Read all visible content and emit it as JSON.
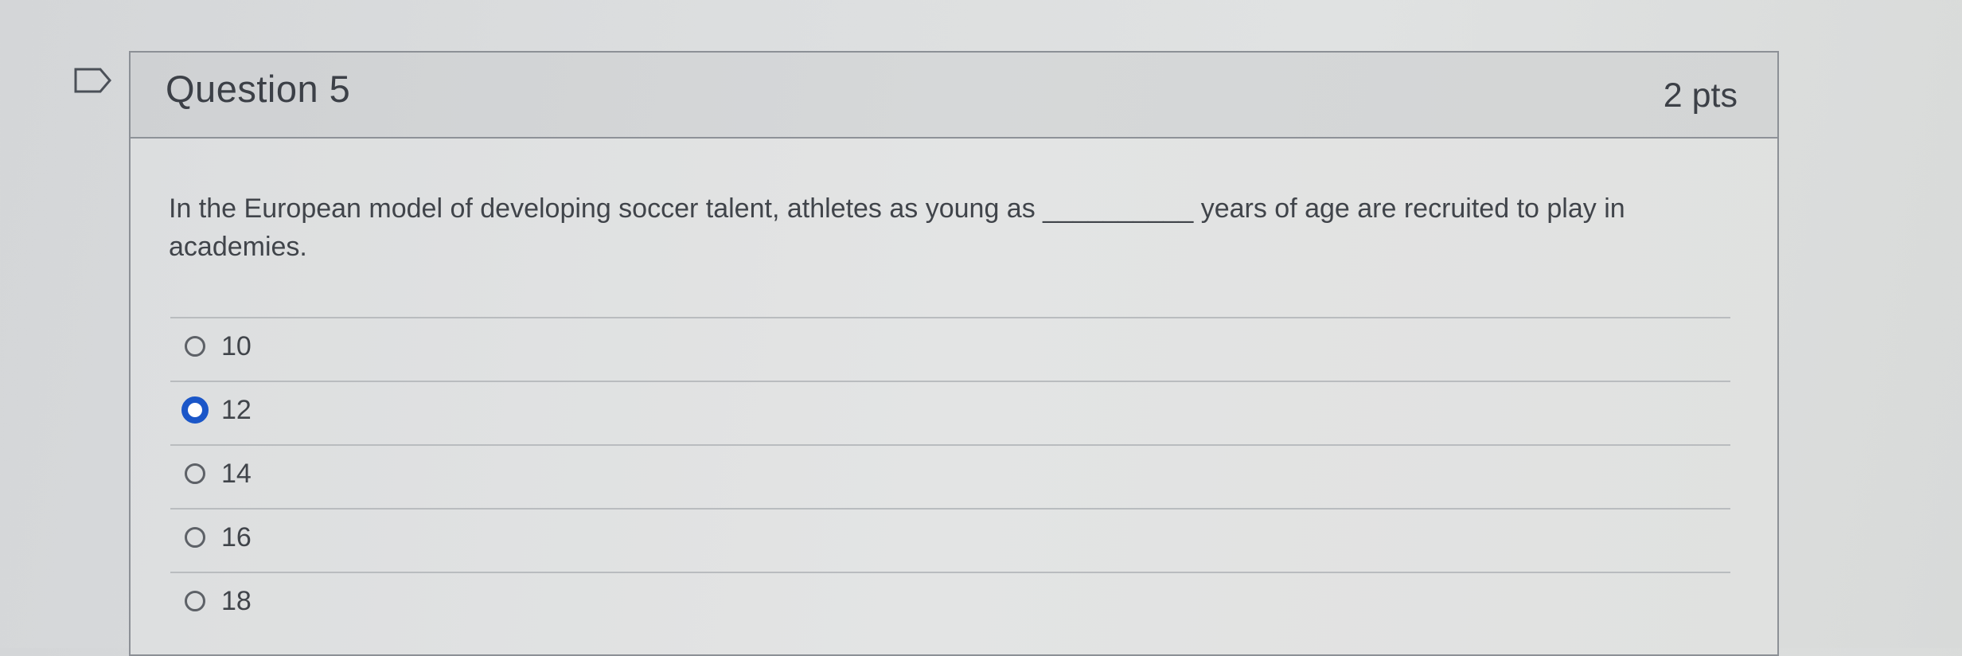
{
  "question": {
    "title": "Question 5",
    "points": "2 pts",
    "text": "In the European model of developing soccer talent, athletes as young as __________ years of age are recruited to play in academies.",
    "flag_icon": "flag-outline-icon"
  },
  "answers": [
    {
      "label": "10",
      "selected": false
    },
    {
      "label": "12",
      "selected": true
    },
    {
      "label": "14",
      "selected": false
    },
    {
      "label": "16",
      "selected": false
    },
    {
      "label": "18",
      "selected": false
    }
  ],
  "colors": {
    "selected_radio": "#1a56c8",
    "card_border": "#8c9096",
    "text": "#40444a"
  }
}
